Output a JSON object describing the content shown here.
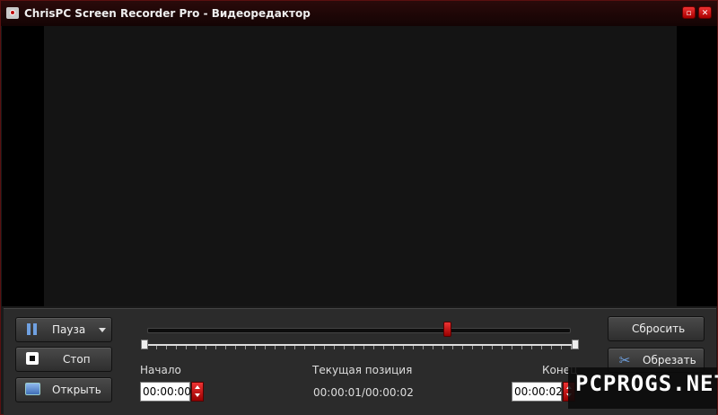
{
  "window": {
    "title": "ChrisPC Screen Recorder Pro - Видеоредактор"
  },
  "titlebar_buttons": {
    "minimize": "▫",
    "close": "✕"
  },
  "controls": {
    "pause_label": "Пауза",
    "stop_label": "Стоп",
    "open_label": "Открыть",
    "reset_label": "Сбросить",
    "cut_label": "Обрезать"
  },
  "timeline": {
    "start_label": "Начало",
    "start_value": "00:00:00",
    "current_label": "Текущая позиция",
    "current_value": "00:00:01/00:00:02",
    "end_label": "Конец",
    "end_value": "00:00:02",
    "playhead_fraction": 0.71
  },
  "watermark": {
    "text": "PCPROGS.NET"
  },
  "icons": {
    "app": "record-icon",
    "pause": "pause-icon",
    "stop": "stop-icon",
    "open": "folder-open-icon",
    "cut": "scissors-icon"
  },
  "colors": {
    "accent": "#cc2222",
    "frame": "#5a1010",
    "panel": "#2b2b2b"
  }
}
